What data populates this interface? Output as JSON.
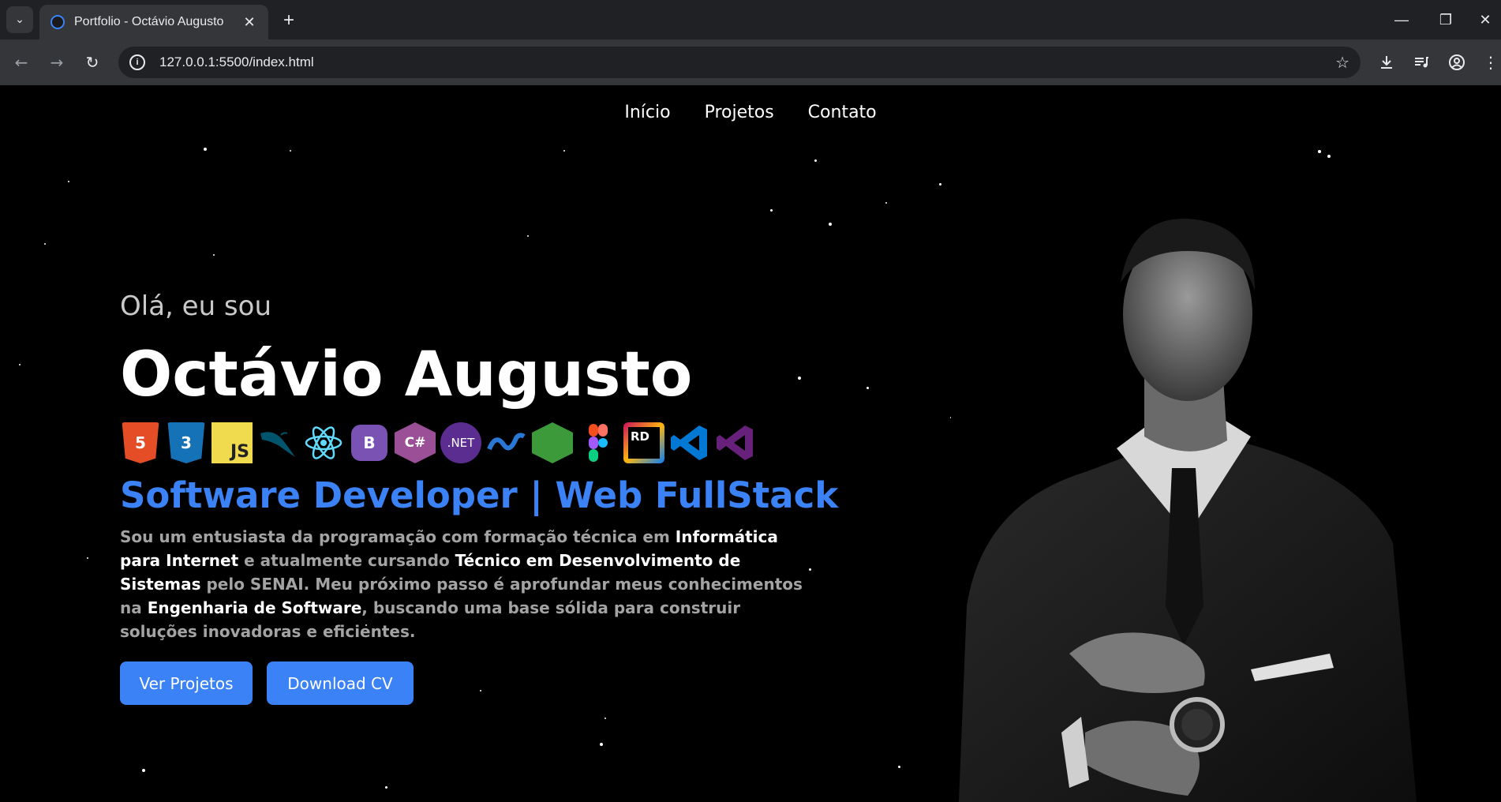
{
  "browser": {
    "tab_title": "Portfolio - Octávio Augusto",
    "url": "127.0.0.1:5500/index.html",
    "icons": [
      "tab-search-icon",
      "close-icon",
      "new-tab-icon",
      "minimize-icon",
      "maximize-icon",
      "close-window-icon",
      "back-icon",
      "forward-icon",
      "reload-icon",
      "site-info-icon",
      "bookmark-star-icon",
      "download-icon",
      "media-icon",
      "profile-icon",
      "menu-icon"
    ]
  },
  "nav": {
    "items": [
      "Início",
      "Projetos",
      "Contato"
    ]
  },
  "hero": {
    "greeting": "Olá, eu sou",
    "name": "Octávio Augusto",
    "role": "Software Developer | Web FullStack",
    "bio": {
      "p1": "Sou um entusiasta da programação com formação técnica em ",
      "b1": "Informática para Internet",
      "p2": " e atualmente cursando ",
      "b2": "Técnico em Desenvolvimento de Sistemas",
      "p3": " pelo SENAI. Meu próximo passo é aprofundar meus conhecimentos na ",
      "b3": "Engenharia de Software",
      "p4": ", buscando uma base sólida para construir soluções inovadoras e eficientes."
    },
    "buttons": {
      "projects": "Ver Projetos",
      "cv": "Download CV"
    },
    "tech_labels": {
      "html": "5",
      "css": "3",
      "js": "JS",
      "bootstrap": "B",
      "csharp": "C#",
      "dotnet": ".NET",
      "rider": "RD"
    },
    "tech_icons": [
      "html5-icon",
      "css3-icon",
      "javascript-icon",
      "mysql-icon",
      "react-icon",
      "bootstrap-icon",
      "csharp-icon",
      "dotnet-core-icon",
      "dotnet-icon",
      "nodejs-icon",
      "figma-icon",
      "rider-icon",
      "vscode-icon",
      "visual-studio-icon"
    ]
  },
  "colors": {
    "accent": "#3b82f6",
    "background": "#000000",
    "chrome_dark": "#202124",
    "chrome_toolbar": "#35363a"
  }
}
